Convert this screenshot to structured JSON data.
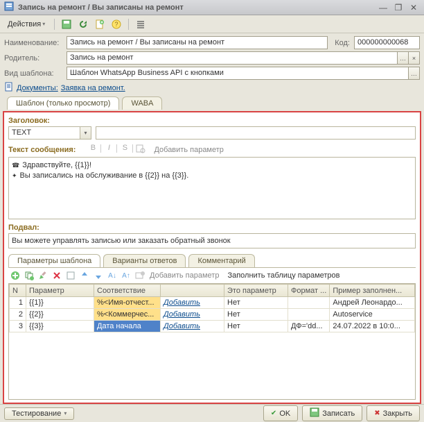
{
  "window": {
    "title": "Запись на ремонт / Вы записаны на ремонт",
    "minimize_icon": "—",
    "restore_icon": "❐",
    "close_icon": "✕"
  },
  "main_toolbar": {
    "actions_label": "Действия"
  },
  "form": {
    "name_label": "Наименование:",
    "name_value": "Запись на ремонт / Вы записаны на ремонт",
    "code_label": "Код:",
    "code_value": "000000000068",
    "parent_label": "Родитель:",
    "parent_value": "Запись на ремонт",
    "parent_btn1": "…",
    "parent_btn2": "×",
    "template_label": "Вид шаблона:",
    "template_value": "Шаблон WhatsApp Business API с кнопками",
    "template_btn": "…"
  },
  "docs_link": {
    "prefix": "Документы:",
    "text": "Заявка на ремонт."
  },
  "tabs": {
    "template_readonly": "Шаблон (только просмотр)",
    "waba": "WABA"
  },
  "header_section": {
    "label": "Заголовок:",
    "type_value": "TEXT"
  },
  "message_section": {
    "label": "Текст сообщения:",
    "fmt_b": "B",
    "fmt_i": "I",
    "fmt_s": "S",
    "add_param": "Добавить параметр",
    "line1": "Здравствуйте, {{1}}!",
    "line2": "Вы записались на обслуживание в {{2}} на {{3}}."
  },
  "footer_section": {
    "label": "Подвал:",
    "value": "Вы можете управлять записью или заказать обратный звонок"
  },
  "subtabs": {
    "params": "Параметры шаблона",
    "answers": "Варианты ответов",
    "comment": "Комментарий"
  },
  "grid_toolbar": {
    "add_param": "Добавить параметр",
    "fill_table": "Заполнить таблицу параметров"
  },
  "grid": {
    "col_n": "N",
    "col_param": "Параметр",
    "col_corr": "Соответствие",
    "col_corr2": "",
    "col_isparam": "Это параметр",
    "col_fmt": "Формат ...",
    "col_example": "Пример заполнен...",
    "rows": [
      {
        "n": "1",
        "param": "{{1}}",
        "corr": "%<Имя-отчест...",
        "add": "Добавить",
        "isparam": "Нет",
        "fmt": "",
        "ex": "Андрей Леонардо..."
      },
      {
        "n": "2",
        "param": "{{2}}",
        "corr": "%<Коммерчес...",
        "add": "Добавить",
        "isparam": "Нет",
        "fmt": "",
        "ex": "Autoservice"
      },
      {
        "n": "3",
        "param": "{{3}}",
        "corr": "Дата начала",
        "add": "Добавить",
        "isparam": "Нет",
        "fmt": "ДФ='dd...",
        "ex": "24.07.2022 в 10:0..."
      }
    ]
  },
  "bottom": {
    "testing": "Тестирование",
    "ok": "OK",
    "save": "Записать",
    "close": "Закрыть"
  }
}
